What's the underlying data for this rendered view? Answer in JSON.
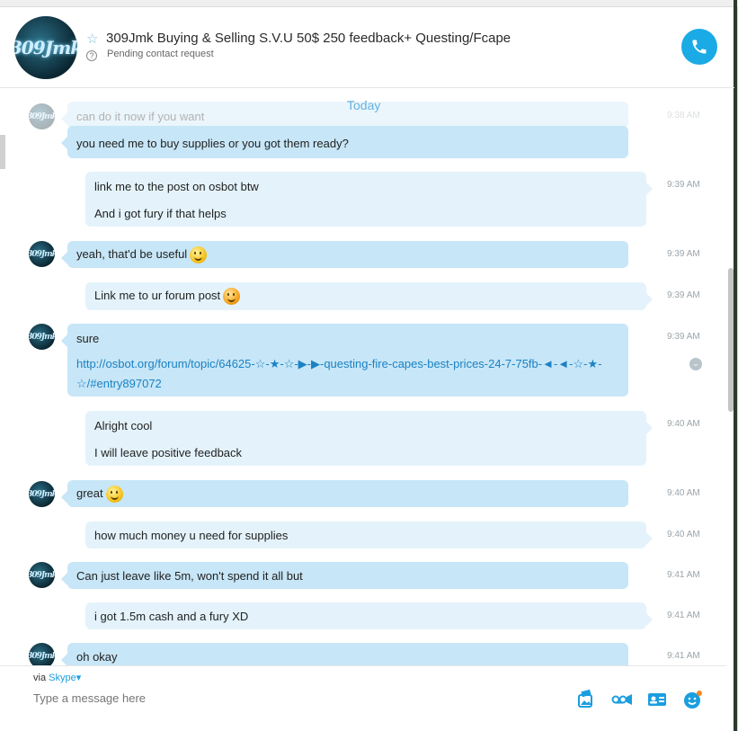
{
  "header": {
    "title": "309Jmk Buying & Selling S.V.U 50$ 250 feedback+ Questing/Fcape",
    "subtitle": "Pending contact request",
    "avatar_text": "309Jmk"
  },
  "chat": {
    "date_divider": "Today",
    "messages": [
      {
        "from": "them",
        "lines": [
          "can do it now if you want"
        ],
        "time": "9:38 AM",
        "faded": true
      },
      {
        "from": "them",
        "lines": [
          "you need me to buy supplies or you got them ready?"
        ],
        "time": ""
      },
      {
        "from": "me",
        "lines": [
          "link me to the post on osbot btw",
          "And i got fury if that helps"
        ],
        "time": "9:39 AM"
      },
      {
        "from": "them",
        "lines": [
          "yeah, that'd be useful"
        ],
        "time": "9:39 AM",
        "emoji": "smile"
      },
      {
        "from": "me",
        "lines": [
          "Link me to ur forum post"
        ],
        "time": "9:39 AM",
        "emoji": "yum"
      },
      {
        "from": "them",
        "lines": [
          "sure"
        ],
        "link": "http://osbot.org/forum/topic/64625-☆-★-☆-▶-▶-questing-fire-capes-best-prices-24-7-75fb-◄-◄-☆-★-☆/#entry897072",
        "time": "9:39 AM"
      },
      {
        "from": "me",
        "lines": [
          "Alright cool",
          "I will leave positive feedback"
        ],
        "time": "9:40 AM"
      },
      {
        "from": "them",
        "lines": [
          "great"
        ],
        "time": "9:40 AM",
        "emoji": "smile"
      },
      {
        "from": "me",
        "lines": [
          "how much money u need for supplies"
        ],
        "time": "9:40 AM"
      },
      {
        "from": "them",
        "lines": [
          "Can just leave like 5m, won't spend it all but"
        ],
        "time": "9:41 AM"
      },
      {
        "from": "me",
        "lines": [
          "i got 1.5m cash and a fury XD"
        ],
        "time": "9:41 AM"
      },
      {
        "from": "them",
        "lines": [
          "oh okay"
        ],
        "time": "9:41 AM"
      }
    ]
  },
  "composer": {
    "via_label": "via",
    "via_service": "Skype",
    "placeholder": "Type a message here"
  },
  "colors": {
    "accent": "#1aaae5",
    "incoming_bubble": "#c7e6f7",
    "outgoing_bubble": "#e4f3fb",
    "link": "#1a82c4"
  },
  "icons": [
    "star-icon",
    "help-icon",
    "phone-icon",
    "image-icon",
    "video-message-icon",
    "contact-card-icon",
    "emoticon-icon"
  ]
}
